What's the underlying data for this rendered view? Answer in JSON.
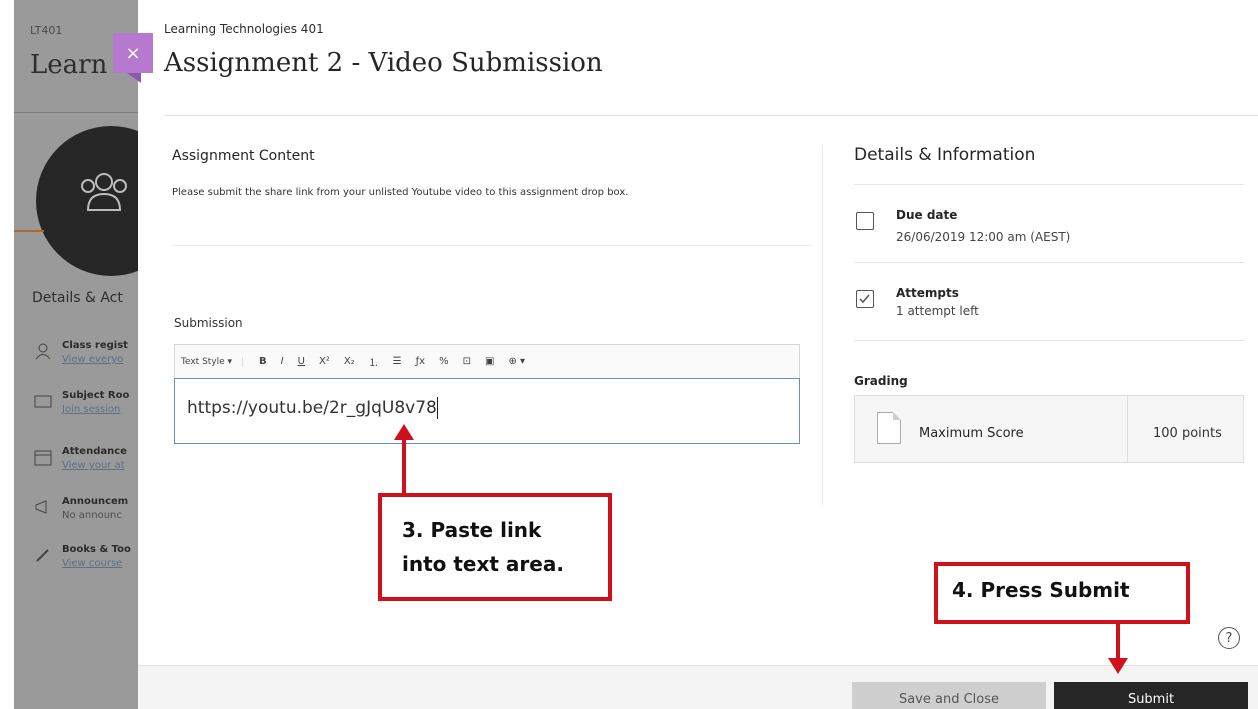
{
  "background": {
    "course_code": "LT401",
    "course_title": "Learn",
    "details_title": "Details & Act",
    "items": [
      {
        "title": "Class regist",
        "sub": "View everyo"
      },
      {
        "title": "Subject Roo",
        "sub": "Join session"
      },
      {
        "title": "Attendance",
        "sub": "View your at"
      },
      {
        "title": "Announcem",
        "sub": "No announc"
      },
      {
        "title": "Books & Too",
        "sub": "View course"
      }
    ]
  },
  "close_glyph": "×",
  "breadcrumb": "Learning Technologies 401",
  "page_title": "Assignment 2 - Video Submission",
  "assignment_content": {
    "heading": "Assignment Content",
    "text": "Please submit the share link from your unlisted Youtube video to this assignment drop box."
  },
  "submission": {
    "label": "Submission",
    "toolbar": {
      "text_style": "Text Style ▾",
      "bold": "B",
      "italic": "I",
      "underline": "U",
      "superscript": "X²",
      "subscript": "X₂",
      "ordered_list": "⒈",
      "bullet_list": "☰",
      "clear_format": "ƒx",
      "link": "%",
      "image": "⊡",
      "media": "▣",
      "more": "⊕ ▾"
    },
    "value": "https://youtu.be/2r_gJqU8v78"
  },
  "details": {
    "heading": "Details & Information",
    "due_label": "Due date",
    "due_value": "26/06/2019 12:00 am (AEST)",
    "attempts_label": "Attempts",
    "attempts_value": "1 attempt left",
    "grading_label": "Grading",
    "max_score_label": "Maximum Score",
    "max_score_value": "100 points"
  },
  "help_glyph": "?",
  "footer": {
    "save_label": "Save and Close",
    "submit_label": "Submit"
  },
  "annotations": {
    "step3_line1": "3. Paste link",
    "step3_line2": "into text area.",
    "step4": "4. Press Submit"
  },
  "colors": {
    "annotation_red": "#d0111b",
    "close_purple": "#b57ad0",
    "submit_dark": "#262626"
  }
}
